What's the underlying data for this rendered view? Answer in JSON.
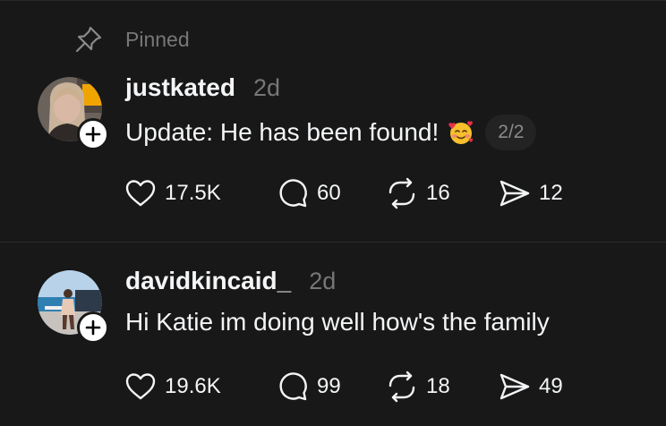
{
  "pinned": {
    "label": "Pinned",
    "icon": "pin-icon"
  },
  "posts": [
    {
      "username": "justkated",
      "time": "2d",
      "text": "Update: He has been found!",
      "emoji": "smiling-face-with-hearts",
      "thread_count": "2/2",
      "likes": "17.5K",
      "replies": "60",
      "reposts": "16",
      "shares": "12"
    },
    {
      "username": "davidkincaid_",
      "time": "2d",
      "text": "Hi Katie im doing well how's the family",
      "likes": "19.6K",
      "replies": "99",
      "reposts": "18",
      "shares": "49"
    }
  ],
  "colors": {
    "background": "#181818",
    "text": "#f3f5f7",
    "secondary": "#777777"
  }
}
